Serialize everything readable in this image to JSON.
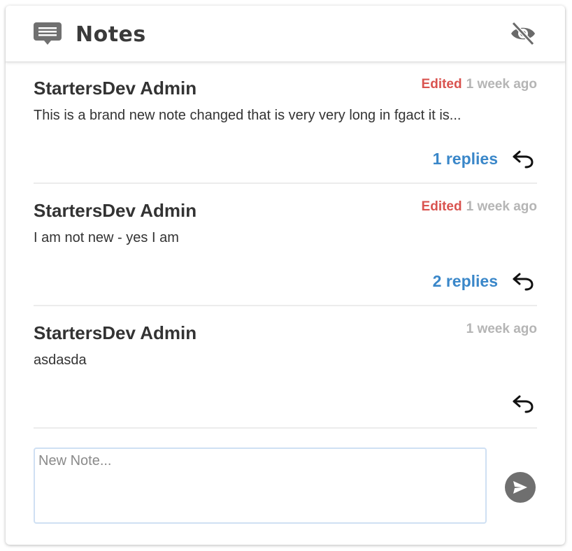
{
  "header": {
    "title": "Notes",
    "title_icon": "chat-bubble-icon",
    "hide_icon": "eye-off-icon"
  },
  "notes": [
    {
      "author": "StartersDev Admin",
      "edited_label": "Edited",
      "time": "1 week ago",
      "text": "This is a brand new note changed that is very very long in fgact it is...",
      "replies_label": "1 replies",
      "reply_icon": "reply-arrow-icon"
    },
    {
      "author": "StartersDev Admin",
      "edited_label": "Edited",
      "time": "1 week ago",
      "text": "I am not new - yes I am",
      "replies_label": "2 replies",
      "reply_icon": "reply-arrow-icon"
    },
    {
      "author": "StartersDev Admin",
      "edited_label": "",
      "time": "1 week ago",
      "text": "asdasda",
      "replies_label": "",
      "reply_icon": "reply-arrow-icon"
    }
  ],
  "composer": {
    "placeholder": "New Note...",
    "value": "",
    "send_icon": "send-icon"
  },
  "colors": {
    "edited": "#d9534f",
    "link": "#3a87c9",
    "muted": "#b5b5b5",
    "send_button": "#6f6f6f"
  }
}
